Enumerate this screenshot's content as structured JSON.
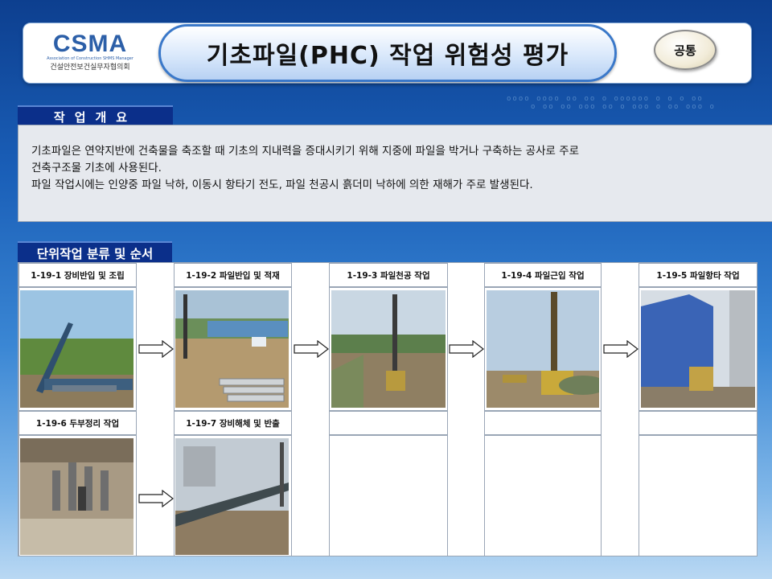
{
  "header": {
    "logo_main": "CSMA",
    "logo_sub": "Association of Construction SHMS Manager",
    "logo_kr": "건설안전보건실무자협의회",
    "title": "기초파일(PHC) 작업 위험성 평가",
    "badge": "공통"
  },
  "overview": {
    "tag": "작업개요",
    "line1": "기초파일은 연약지반에 건축물을 축조할 때 기초의 지내력을 증대시키기 위해 지중에 파일을 박거나 구축하는 공사로 주로",
    "line2": "건축구조물 기초에 사용된다.",
    "line3": "파일 작업시에는 인양중 파일 낙하, 이동시 항타기 전도, 파일 천공시 흙더미 낙하에 의한 재해가 주로 발생된다."
  },
  "units": {
    "tag": "단위작업 분류 및 순서",
    "items": [
      {
        "label": "1-19-1 장비반입 및 조립"
      },
      {
        "label": "1-19-2 파일반입 및 적재"
      },
      {
        "label": "1-19-3 파일천공 작업"
      },
      {
        "label": "1-19-4 파일근입 작업"
      },
      {
        "label": "1-19-5 파일항타 작업"
      },
      {
        "label": "1-19-6 두부정리 작업"
      },
      {
        "label": "1-19-7 장비해체 및 반출"
      }
    ]
  },
  "colors": {
    "accent": "#0b2f8a",
    "title_border": "#3a78c9"
  }
}
